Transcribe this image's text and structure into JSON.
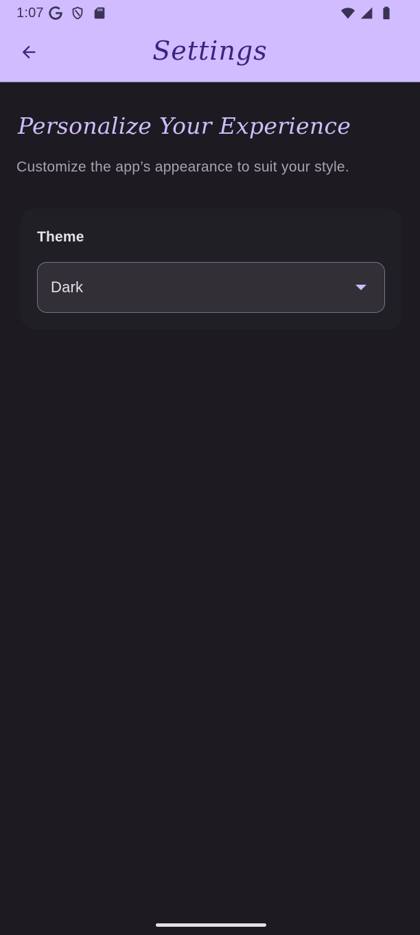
{
  "status_bar": {
    "time": "1:07",
    "left_icons": [
      "google-icon",
      "shield-icon",
      "sd-card-icon"
    ],
    "right_icons": [
      "wifi-icon",
      "signal-icon",
      "battery-icon"
    ]
  },
  "app_bar": {
    "title": "Settings",
    "back_icon": "arrow-back-icon"
  },
  "main": {
    "heading": "Personalize Your Experience",
    "description": "Customize the app’s appearance to suit your style."
  },
  "theme_card": {
    "label": "Theme",
    "selected_value": "Dark",
    "dropdown_icon": "arrow-drop-down-icon"
  },
  "colors": {
    "app_bar_background": "#d0bcff",
    "app_bar_title": "#3b2380",
    "accent": "#d0bcff",
    "background": "#1d1b21",
    "card_background": "#211f26",
    "dropdown_background": "#322f37"
  }
}
